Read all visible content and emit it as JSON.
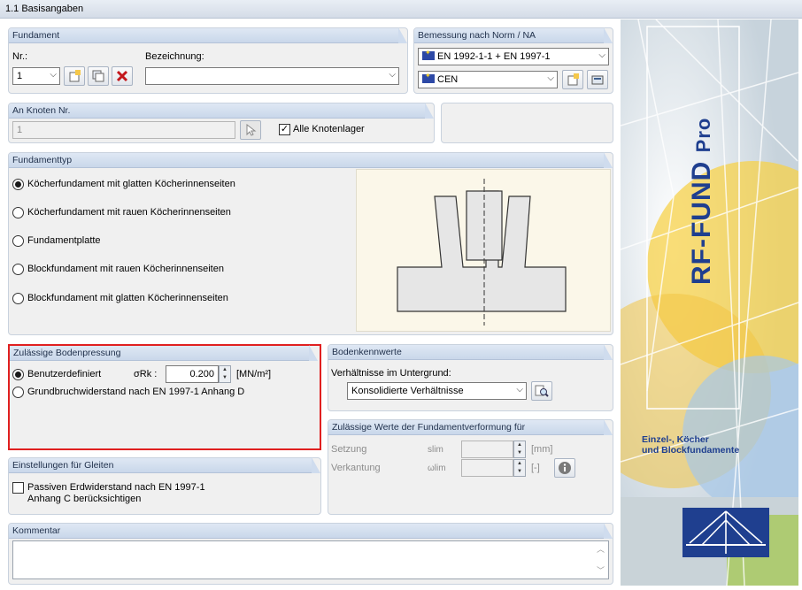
{
  "title": "1.1 Basisangaben",
  "fundament": {
    "header": "Fundament",
    "nr_label": "Nr.:",
    "nr_value": "1",
    "bezeichnung_label": "Bezeichnung:",
    "bezeichnung_value": ""
  },
  "norm": {
    "header": "Bemessung nach Norm / NA",
    "standard": "EN 1992-1-1 + EN 1997-1",
    "annex": "CEN"
  },
  "knoten": {
    "header": "An Knoten Nr.",
    "value": "1",
    "alle_label": "Alle Knotenlager",
    "alle_checked": true
  },
  "fundamenttyp": {
    "header": "Fundamenttyp",
    "options": [
      {
        "label": "Köcherfundament mit glatten Köcherinnenseiten",
        "selected": true
      },
      {
        "label": "Köcherfundament mit rauen Köcherinnenseiten",
        "selected": false
      },
      {
        "label": "Fundamentplatte",
        "selected": false
      },
      {
        "label": "Blockfundament mit rauen Köcherinnenseiten",
        "selected": false
      },
      {
        "label": "Blockfundament mit glatten Köcherinnenseiten",
        "selected": false
      }
    ]
  },
  "bodenpressung": {
    "header": "Zulässige Bodenpressung",
    "opt1": "Benutzerdefiniert",
    "sigma_label": "σRk :",
    "sigma_value": "0.200",
    "sigma_unit": "[MN/m²]",
    "opt2": "Grundbruchwiderstand nach EN 1997-1 Anhang D"
  },
  "bodenkennwerte": {
    "header": "Bodenkennwerte",
    "label": "Verhältnisse im Untergrund:",
    "value": "Konsolidierte Verhältnisse"
  },
  "verformung": {
    "header": "Zulässige Werte der Fundamentverformung für",
    "setzung_label": "Setzung",
    "setzung_sym": "slim",
    "setzung_unit": "[mm]",
    "verkantung_label": "Verkantung",
    "verkantung_sym": "ωlim",
    "verkantung_unit": "[-]"
  },
  "gleiten": {
    "header": "Einstellungen für Gleiten",
    "line1": "Passiven Erdwiderstand nach EN 1997-1",
    "line2": "Anhang C berücksichtigen"
  },
  "kommentar": {
    "header": "Kommentar",
    "value": ""
  },
  "brand": {
    "name": "RF-FUND",
    "suffix": "Pro",
    "desc1": "Einzel-, Köcher",
    "desc2": "und Blockfundamente"
  },
  "colors": {
    "highlight_border": "#e02020",
    "panel_header": "#d3dff0",
    "brand_blue": "#1f3f8f"
  }
}
